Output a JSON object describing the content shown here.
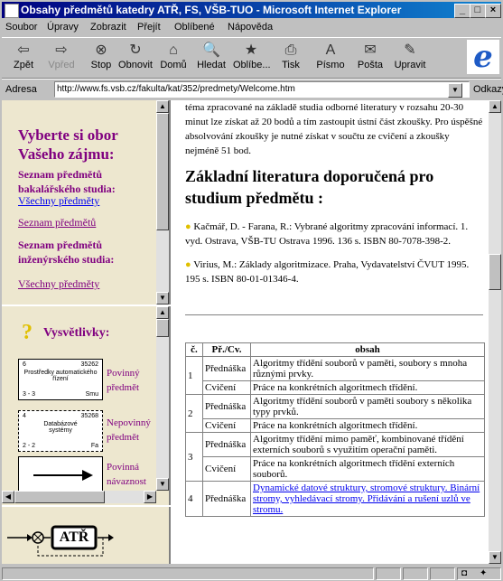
{
  "window": {
    "title": "Obsahy předmětů katedry ATŘ, FS, VŠB-TUO - Microsoft Internet Explorer"
  },
  "menu": [
    "Soubor",
    "Úpravy",
    "Zobrazit",
    "Přejít",
    "Oblíbené",
    "Nápověda"
  ],
  "toolbar": [
    {
      "label": "Zpět",
      "icon": "back-icon",
      "glyph": "⇦",
      "enabled": true
    },
    {
      "label": "Vpřed",
      "icon": "forward-icon",
      "glyph": "⇨",
      "enabled": false
    },
    {
      "label": "Stop",
      "icon": "stop-icon",
      "glyph": "⊗",
      "enabled": true
    },
    {
      "label": "Obnovit",
      "icon": "refresh-icon",
      "glyph": "↻",
      "enabled": true
    },
    {
      "label": "Domů",
      "icon": "home-icon",
      "glyph": "⌂",
      "enabled": true
    },
    {
      "label": "Hledat",
      "icon": "search-icon",
      "glyph": "🔍",
      "enabled": true
    },
    {
      "label": "Oblíbe...",
      "icon": "favorites-icon",
      "glyph": "★",
      "enabled": true
    },
    {
      "label": "Tisk",
      "icon": "print-icon",
      "glyph": "⎙",
      "enabled": true
    },
    {
      "label": "Písmo",
      "icon": "font-icon",
      "glyph": "A",
      "enabled": true
    },
    {
      "label": "Pošta",
      "icon": "mail-icon",
      "glyph": "✉",
      "enabled": true
    },
    {
      "label": "Upravit",
      "icon": "edit-icon",
      "glyph": "✎",
      "enabled": true
    }
  ],
  "address": {
    "label": "Adresa",
    "url": "http://www.fs.vsb.cz/fakulta/kat/352/predmety/Welcome.htm",
    "links_label": "Odkazy"
  },
  "left_nav": {
    "heading": "Vyberte si obor Vašeho zájmu:",
    "bachelor_heading": "Seznam předmětů bakalářského studia:",
    "bachelor_all": "Všechny předměty",
    "bachelor_list": "Seznam předmětů",
    "eng_heading": "Seznam předmětů inženýrského studia:",
    "eng_all": "Všechny předměty"
  },
  "legend": {
    "title": "Vysvětlivky:",
    "box1": {
      "num": "6",
      "code": "35262",
      "name": "Prostředky automatického řízení",
      "credits": "3 - 3",
      "type": "Smu"
    },
    "box1_label": "Povinný předmět",
    "box2": {
      "num": "4",
      "code": "35268",
      "name": "Databázové systémy",
      "credits": "2 - 2",
      "type": "Fa"
    },
    "box2_label": "Nepovinný předmět",
    "arrow_label": "Povinná návaznost"
  },
  "logo": {
    "text": "ATŘ"
  },
  "main": {
    "intro": "téma zpracované na základě studia odborné literatury v rozsahu 20-30 minut lze získat až 20 bodů a tím zastoupit ústní část zkoušky. Pro úspěšné absolvování zkoušky je nutné získat v součtu ze cvičení a zkoušky nejméně 51 bod.",
    "lit_heading": "Základní literatura doporučená pro studium předmětu :",
    "lit": [
      "Kačmář, D. - Farana, R.: Vybrané algoritmy zpracování informací. 1. vyd. Ostrava, VŠB-TU Ostrava 1996. 136 s. ISBN 80-7078-398-2.",
      "Virius, M.: Základy algoritmizace. Praha, Vydavatelství ČVUT 1995. 195 s. ISBN 80-01-01346-4."
    ],
    "table_headers": [
      "č.",
      "Př./Cv.",
      "obsah"
    ],
    "rows": [
      {
        "n": "1",
        "type1": "Přednáška",
        "c1": "Algoritmy třídění souborů v paměti, soubory s mnoha různými prvky.",
        "type2": "Cvičení",
        "c2": "Práce na konkrétních algoritmech třídění."
      },
      {
        "n": "2",
        "type1": "Přednáška",
        "c1": "Algoritmy třídění souborů v paměti soubory s několika typy prvků.",
        "type2": "Cvičení",
        "c2": "Práce na konkrétních algoritmech třídění."
      },
      {
        "n": "3",
        "type1": "Přednáška",
        "c1": "Algoritmy třídění mimo paměť, kombinované třídění externích souborů s využitím operační paměti.",
        "type2": "Cvičení",
        "c2": "Práce na konkrétních algoritmech třídění externích souborů."
      },
      {
        "n": "4",
        "type1": "Přednáška",
        "c1": "Dynamické datové struktury, stromové struktury. Binární stromy, vyhledávací stromy. Přidávání a rušení uzlů ve stromu."
      }
    ]
  }
}
